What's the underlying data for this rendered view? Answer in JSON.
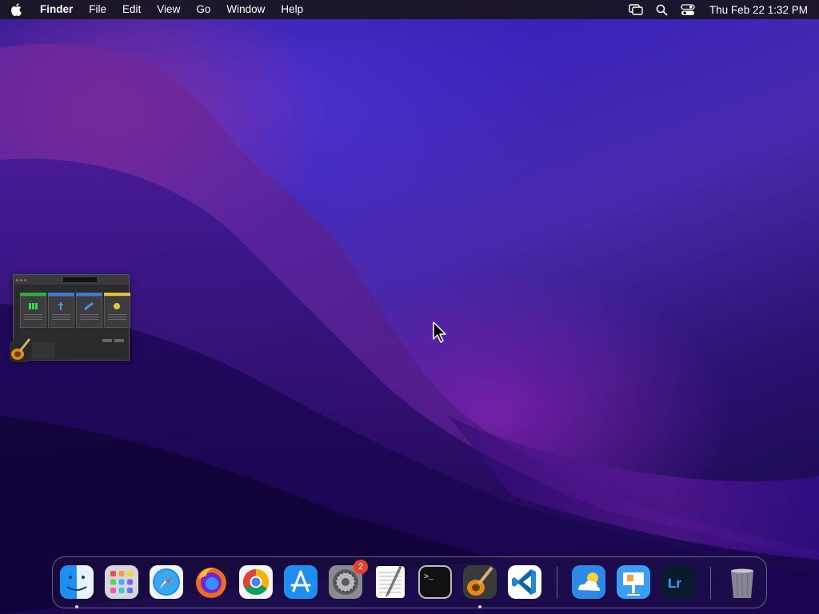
{
  "menubar": {
    "app_name": "Finder",
    "menus": [
      "File",
      "Edit",
      "View",
      "Go",
      "Window",
      "Help"
    ],
    "icons": [
      "apple-icon",
      "screen-mirroring-icon",
      "spotlight-search-icon",
      "control-center-icon"
    ],
    "clock": "Thu Feb 22  1:32 PM"
  },
  "desktop": {
    "minimized_window_app_icon": "garageband-icon"
  },
  "dock": {
    "apps": [
      {
        "name": "Finder",
        "icon": "finder-icon",
        "running": true
      },
      {
        "name": "Launchpad",
        "icon": "launchpad-icon",
        "running": false
      },
      {
        "name": "Safari",
        "icon": "safari-icon",
        "running": false
      },
      {
        "name": "Firefox",
        "icon": "firefox-icon",
        "running": false
      },
      {
        "name": "Google Chrome",
        "icon": "chrome-icon",
        "running": false
      },
      {
        "name": "App Store",
        "icon": "app-store-icon",
        "running": false
      },
      {
        "name": "System Preferences",
        "icon": "system-preferences-icon",
        "running": false,
        "badge": "2"
      },
      {
        "name": "TextEdit",
        "icon": "textedit-icon",
        "running": false
      },
      {
        "name": "Terminal",
        "icon": "terminal-icon",
        "running": false
      },
      {
        "name": "GarageBand",
        "icon": "garageband-icon",
        "running": true
      },
      {
        "name": "Visual Studio Code",
        "icon": "vscode-icon",
        "running": false
      },
      {
        "name": "Weather",
        "icon": "weather-icon",
        "running": false
      },
      {
        "name": "Keynote",
        "icon": "keynote-icon",
        "running": false
      },
      {
        "name": "Lightroom",
        "icon": "lightroom-icon",
        "running": false,
        "label": "Lr"
      },
      {
        "name": "Trash",
        "icon": "trash-icon",
        "running": false
      }
    ]
  },
  "colors": {
    "menubar_bg": "#19161e",
    "badge": "#e8402f",
    "wallpaper_primary": "#3a22b8",
    "wallpaper_accent": "#aa28c8"
  }
}
